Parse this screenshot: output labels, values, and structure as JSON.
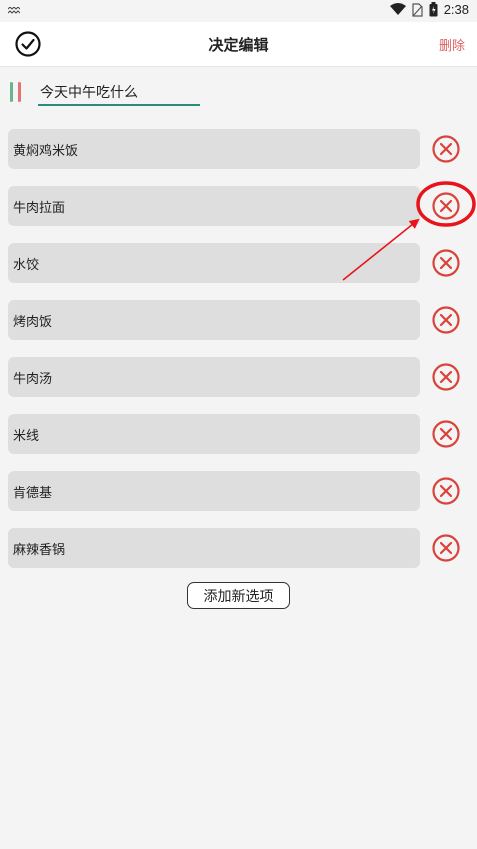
{
  "status_bar": {
    "time": "2:38"
  },
  "header": {
    "title": "决定编辑",
    "delete_label": "删除"
  },
  "decision": {
    "title_value": "今天中午吃什么"
  },
  "options": [
    "黄焖鸡米饭",
    "牛肉拉面",
    "水饺",
    "烤肉饭",
    "牛肉汤",
    "米线",
    "肯德基",
    "麻辣香锅"
  ],
  "add_option_label": "添加新选项",
  "colors": {
    "accent": "#2e8a7a",
    "remove": "#d9433a",
    "delete": "#e06060",
    "annotation": "#e8141c"
  },
  "icons": {
    "confirm": "check-circle-icon",
    "remove": "x-circle-icon",
    "drag": "drag-handle-icon"
  }
}
